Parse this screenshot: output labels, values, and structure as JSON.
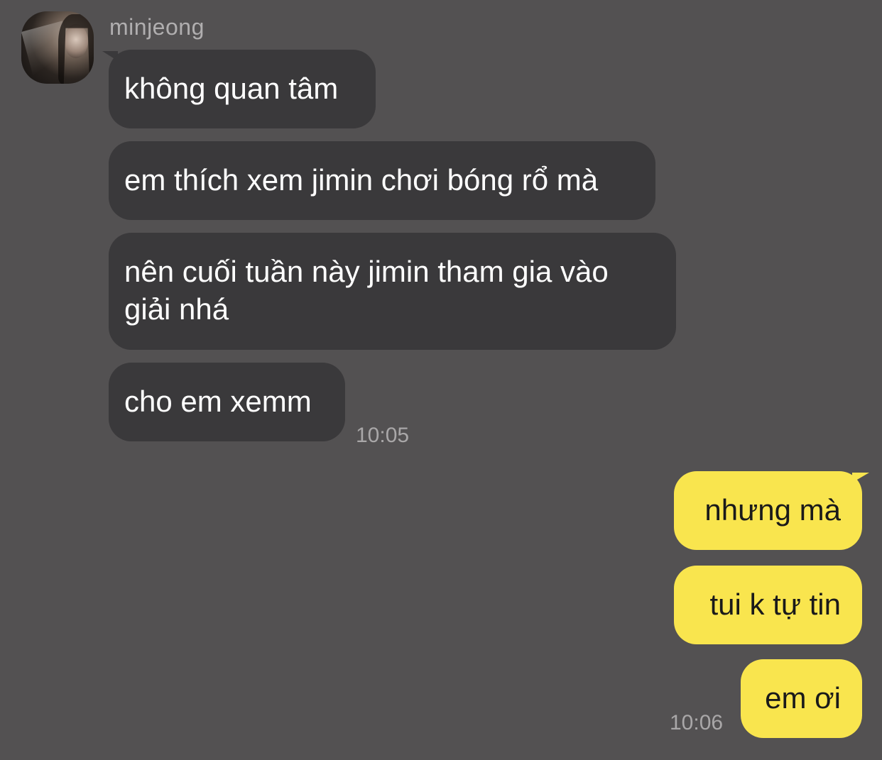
{
  "conversation": {
    "contact": {
      "name": "minjeong",
      "avatar": "avatar-photo"
    },
    "incoming": {
      "messages": [
        "không quan tâm",
        "em thích xem jimin chơi bóng rổ mà",
        "nên cuối tuần này jimin tham gia vào giải nhá",
        "cho em xemm"
      ],
      "time": "10:05"
    },
    "outgoing": {
      "messages": [
        "nhưng mà",
        "tui k tự tin",
        "em ơi"
      ],
      "time": "10:06"
    }
  },
  "colors": {
    "background": "#535152",
    "incoming_bubble": "#3a393b",
    "outgoing_bubble": "#f9e54e"
  }
}
